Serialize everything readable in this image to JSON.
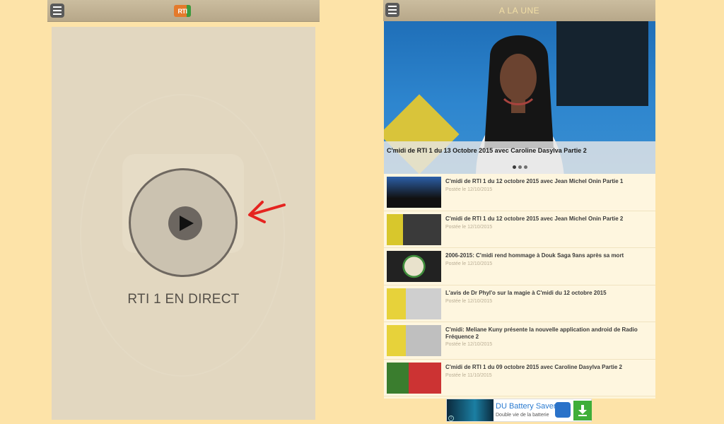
{
  "left": {
    "logo_text": "RTI",
    "live_label": "RTI 1 EN DIRECT"
  },
  "right": {
    "title": "A LA UNE",
    "hero": {
      "caption": "C'midi de RTI 1 du 13 Octobre 2015 avec Caroline Dasylva Partie 2"
    },
    "items": [
      {
        "title": "C'midi de RTI 1 du 12 octobre 2015 avec Jean Michel Onin Partie 1",
        "date": "Postée le 12/10/2015"
      },
      {
        "title": "C'midi de RTI 1 du 12 octobre 2015 avec Jean Michel Onin Partie 2",
        "date": "Postée le 12/10/2015"
      },
      {
        "title": "2006-2015: C'midi rend hommage à Douk Saga 9ans après sa mort",
        "date": "Postée le 12/10/2015"
      },
      {
        "title": "L'avis de Dr Phyl'o sur la magie à C'midi du 12 octobre 2015",
        "date": "Postée le 12/10/2015"
      },
      {
        "title": "C'midi: Meliane Kuny présente la nouvelle application android de Radio Fréquence 2",
        "date": "Postée le 12/10/2015"
      },
      {
        "title": "C'midi de RTI 1 du 09 octobre 2015 avec Caroline Dasylva Partie 2",
        "date": "Postée le 11/10/2015"
      }
    ]
  },
  "ad": {
    "title": "DU Battery Saver",
    "subtitle": "Double vie de la batterie",
    "info": "i"
  },
  "colors": {
    "background": "#fde3a8",
    "annotation_arrow": "#e52420",
    "topbar": "#c1b295"
  }
}
